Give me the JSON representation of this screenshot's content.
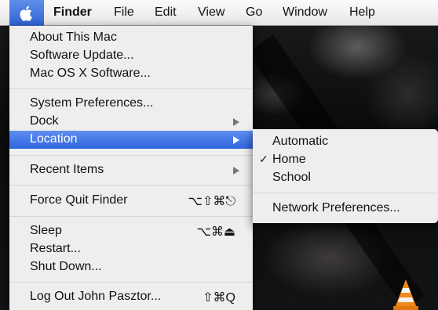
{
  "menubar": {
    "app_name": "Finder",
    "menus": [
      "File",
      "Edit",
      "View",
      "Go",
      "Window",
      "Help"
    ]
  },
  "apple_menu": {
    "about": "About This Mac",
    "software_update": "Software Update...",
    "mac_os_x_software": "Mac OS X Software...",
    "system_preferences": "System Preferences...",
    "dock": "Dock",
    "location": "Location",
    "recent_items": "Recent Items",
    "force_quit": "Force Quit Finder",
    "force_quit_shortcut": "⌥⇧⌘⎋",
    "sleep": "Sleep",
    "sleep_shortcut": "⌥⌘⏏",
    "restart": "Restart...",
    "shut_down": "Shut Down...",
    "log_out": "Log Out John Pasztor...",
    "log_out_shortcut": "⇧⌘Q"
  },
  "location_submenu": {
    "automatic": "Automatic",
    "home": "Home",
    "home_check": "✓",
    "school": "School",
    "network_preferences": "Network Preferences..."
  }
}
